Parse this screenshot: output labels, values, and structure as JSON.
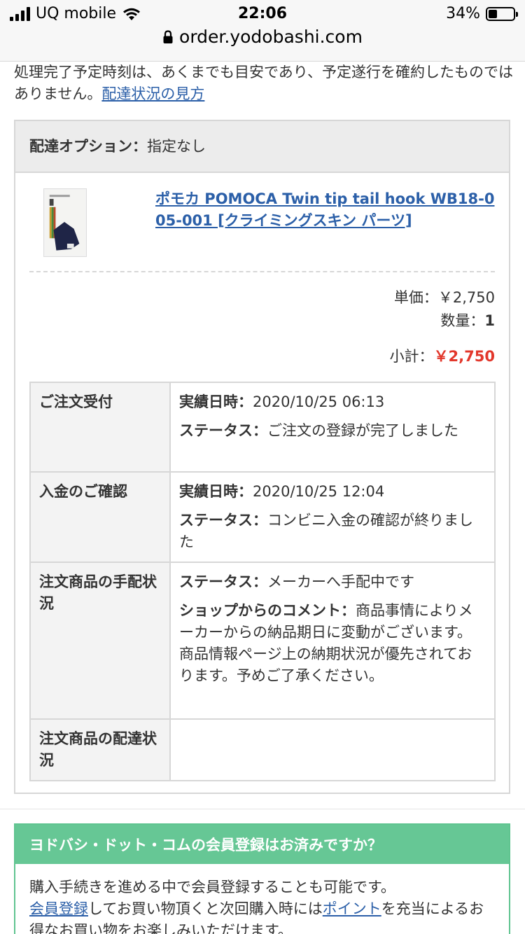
{
  "status_bar": {
    "carrier": "UQ mobile",
    "time": "22:06",
    "battery": "34%",
    "battery_level": 0.34
  },
  "browser": {
    "url": "order.yodobashi.com"
  },
  "intro": {
    "text": "処理完了予定時刻は、あくまでも目安であり、予定遂行を確約したものではありません。",
    "link": "配達状況の見方"
  },
  "delivery_option": {
    "label": "配達オプション：",
    "value": "指定なし"
  },
  "product": {
    "name": "ポモカ POMOCA Twin tip tail hook WB18-005-001 [クライミングスキン パーツ]",
    "name_line1": "ポモカ POMOCA Twin tip tail hook WB18-0",
    "name_line2": "05-001 [クライミングスキン パーツ]",
    "unit_price_label": "単価：",
    "unit_price": "￥2,750",
    "quantity_label": "数量：",
    "quantity": "1",
    "subtotal_label": "小計：",
    "subtotal": "￥2,750"
  },
  "history": [
    {
      "heading": "ご注文受付",
      "lines": [
        {
          "label": "実績日時：",
          "value": "2020/10/25 06:13"
        },
        {
          "label": "ステータス：",
          "value": "ご注文の登録が完了しました"
        }
      ]
    },
    {
      "heading": "入金のご確認",
      "lines": [
        {
          "label": "実績日時：",
          "value": "2020/10/25 12:04"
        },
        {
          "label": "ステータス：",
          "value": "コンビニ入金の確認が終りました"
        }
      ]
    },
    {
      "heading": "注文商品の手配状況",
      "lines": [
        {
          "label": "ステータス：",
          "value": "メーカーへ手配中です"
        },
        {
          "label": "ショップからのコメント：",
          "value": "商品事情によりメーカーからの納品期日に変動がございます。商品情報ページ上の納期状況が優先されております。予めご了承ください。"
        }
      ]
    },
    {
      "heading": "注文商品の配達状況",
      "lines": []
    }
  ],
  "member": {
    "heading": "ヨドバシ・ドット・コムの会員登録はお済みですか？",
    "line1": "購入手続きを進める中で会員登録することも可能です。",
    "link1": "会員登録",
    "text2": "してお買い物頂くと次回購入時には",
    "link2": "ポイント",
    "text3": "を充当によるお得なお買い物をお楽しみいただけます。"
  }
}
